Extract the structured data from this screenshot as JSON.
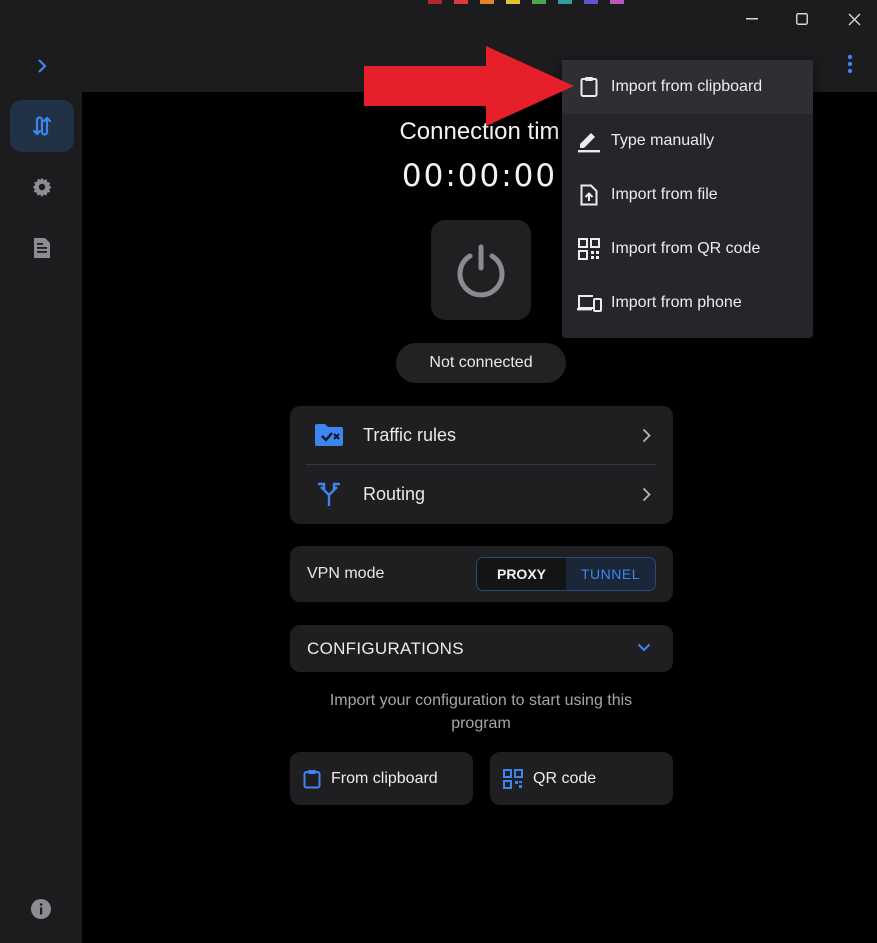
{
  "window": {
    "minimize_glyph": "—",
    "maximize_glyph": "☐",
    "close_glyph": "✕"
  },
  "appbar": {
    "expand_icon": "chevron-right-icon",
    "more_icon": "more-vertical-icon"
  },
  "sidebar": {
    "items": [
      {
        "icon": "connection-icon",
        "active": true
      },
      {
        "icon": "gear-icon",
        "active": false
      },
      {
        "icon": "document-icon",
        "active": false
      }
    ],
    "info_icon": "info-icon"
  },
  "main": {
    "timer_title": "Connection tim",
    "timer_value": "00:00:00",
    "status": "Not connected",
    "rows": [
      {
        "label": "Traffic rules",
        "icon": "folder-check-icon"
      },
      {
        "label": "Routing",
        "icon": "routing-icon"
      }
    ],
    "vpn_mode": {
      "label": "VPN mode",
      "options": [
        "PROXY",
        "TUNNEL"
      ],
      "selected": "TUNNEL"
    },
    "configurations_label": "CONFIGURATIONS",
    "hint": "Import your configuration to start using this program",
    "buttons": {
      "clipboard": "From clipboard",
      "qr": "QR code"
    }
  },
  "menu": {
    "items": [
      {
        "label": "Import from clipboard",
        "icon": "clipboard-icon"
      },
      {
        "label": "Type manually",
        "icon": "pencil-icon"
      },
      {
        "label": "Import from file",
        "icon": "file-upload-icon"
      },
      {
        "label": "Import from QR code",
        "icon": "qr-code-icon"
      },
      {
        "label": "Import from phone",
        "icon": "devices-icon"
      }
    ]
  },
  "colors": {
    "accent": "#3d86f0",
    "arrow": "#e5202a",
    "background": "#000000",
    "panel": "#1f1f22"
  }
}
